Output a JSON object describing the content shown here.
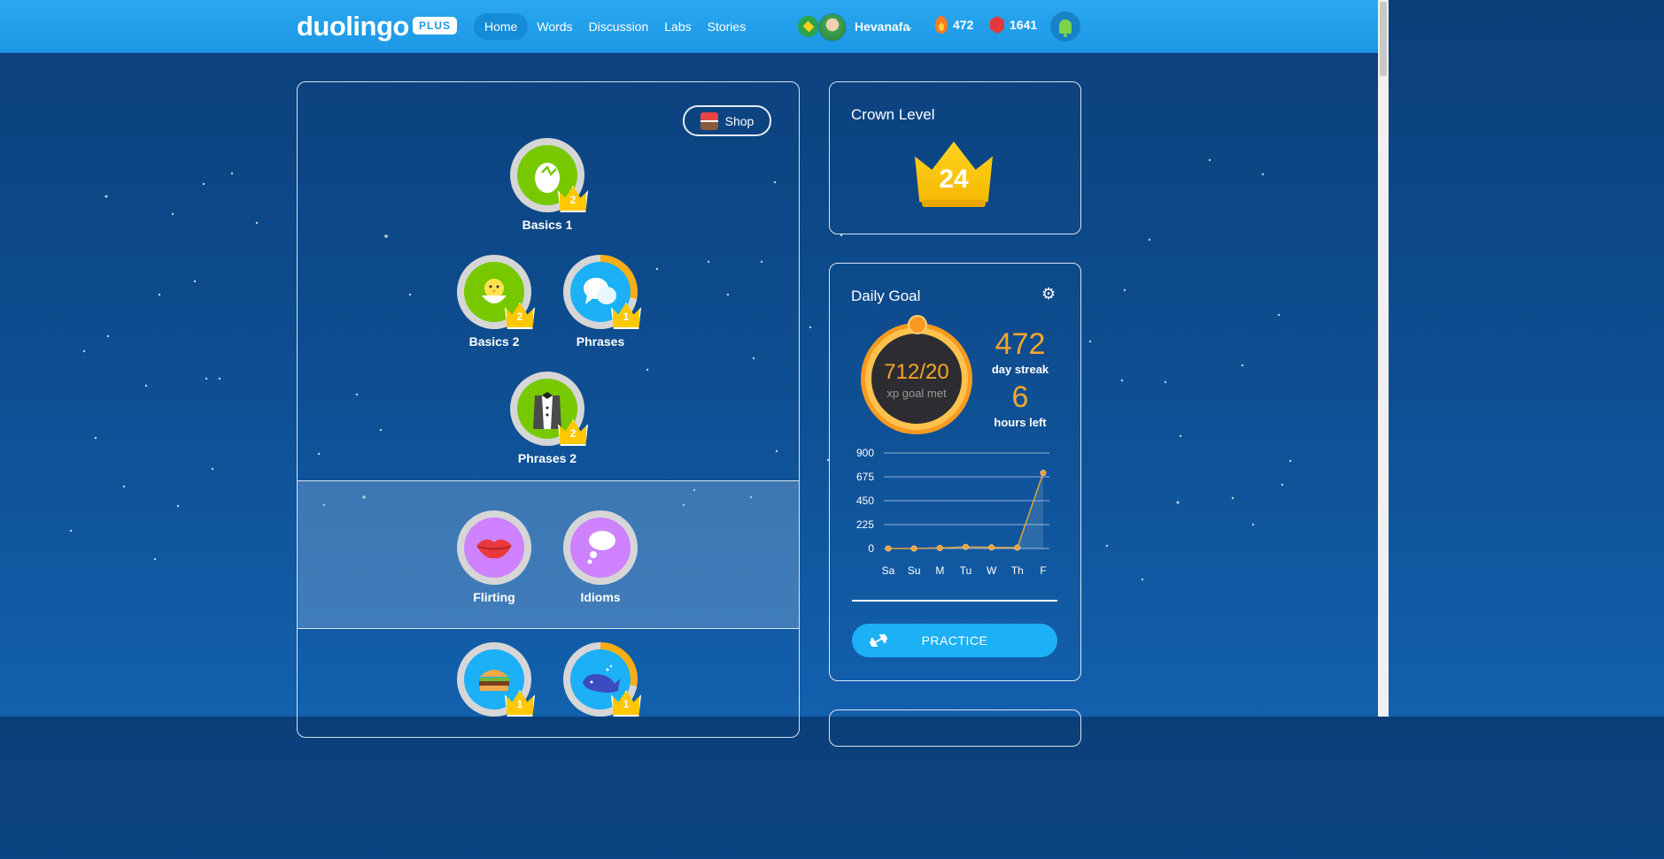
{
  "topbar": {
    "logo": "duolingo",
    "plus_badge": "PLUS",
    "nav": [
      {
        "label": "Home",
        "active": true
      },
      {
        "label": "Words",
        "active": false
      },
      {
        "label": "Discussion",
        "active": false
      },
      {
        "label": "Labs",
        "active": false
      },
      {
        "label": "Stories",
        "active": false
      }
    ],
    "username": "Hevanafa",
    "streak": "472",
    "gems": "1641",
    "icons": [
      "flag-icon",
      "avatar",
      "chevron-down-icon",
      "fire-icon",
      "gem-icon",
      "bell-icon"
    ]
  },
  "tree": {
    "shop_label": "Shop",
    "skills": [
      {
        "name": "Basics 1",
        "crown": "2",
        "color": "green",
        "icon": "egg-icon",
        "progress": 1.0
      },
      {
        "name": "Basics 2",
        "crown": "2",
        "color": "green",
        "icon": "chick-icon",
        "progress": 1.0
      },
      {
        "name": "Phrases",
        "crown": "1",
        "color": "blue",
        "icon": "speech-bubbles-icon",
        "progress": 0.28
      },
      {
        "name": "Phrases 2",
        "crown": "2",
        "color": "green",
        "icon": "tuxedo-icon",
        "progress": 1.0
      },
      {
        "name": "Flirting",
        "crown": "",
        "color": "purple",
        "icon": "lips-icon",
        "progress": 0
      },
      {
        "name": "Idioms",
        "crown": "",
        "color": "purple",
        "icon": "thought-bubble-icon",
        "progress": 0
      },
      {
        "name": "",
        "crown": "1",
        "color": "blue",
        "icon": "burger-icon",
        "progress": 1.0
      },
      {
        "name": "",
        "crown": "1",
        "color": "blue",
        "icon": "whale-icon",
        "progress": 0.28
      }
    ]
  },
  "crown_level": {
    "title": "Crown Level",
    "value": "24"
  },
  "daily_goal": {
    "title": "Daily Goal",
    "ring_value": "712/20",
    "ring_label": "xp goal met",
    "streak_value": "472",
    "streak_label": "day streak",
    "hours_value": "6",
    "hours_label": "hours left",
    "practice_label": "PRACTICE"
  },
  "chart_data": {
    "type": "line",
    "categories": [
      "Sa",
      "Su",
      "M",
      "Tu",
      "W",
      "Th",
      "F"
    ],
    "values": [
      0,
      0,
      5,
      15,
      10,
      8,
      712
    ],
    "yticks": [
      "900",
      "675",
      "450",
      "225",
      "0"
    ],
    "ylim": [
      0,
      900
    ],
    "line_color": "#e3a23a",
    "grid": true
  },
  "colors": {
    "accent_blue": "#1cb0f6",
    "gold": "#ffc800",
    "orange": "#f9a62b",
    "green": "#78c800",
    "purple": "#ce82ff"
  }
}
